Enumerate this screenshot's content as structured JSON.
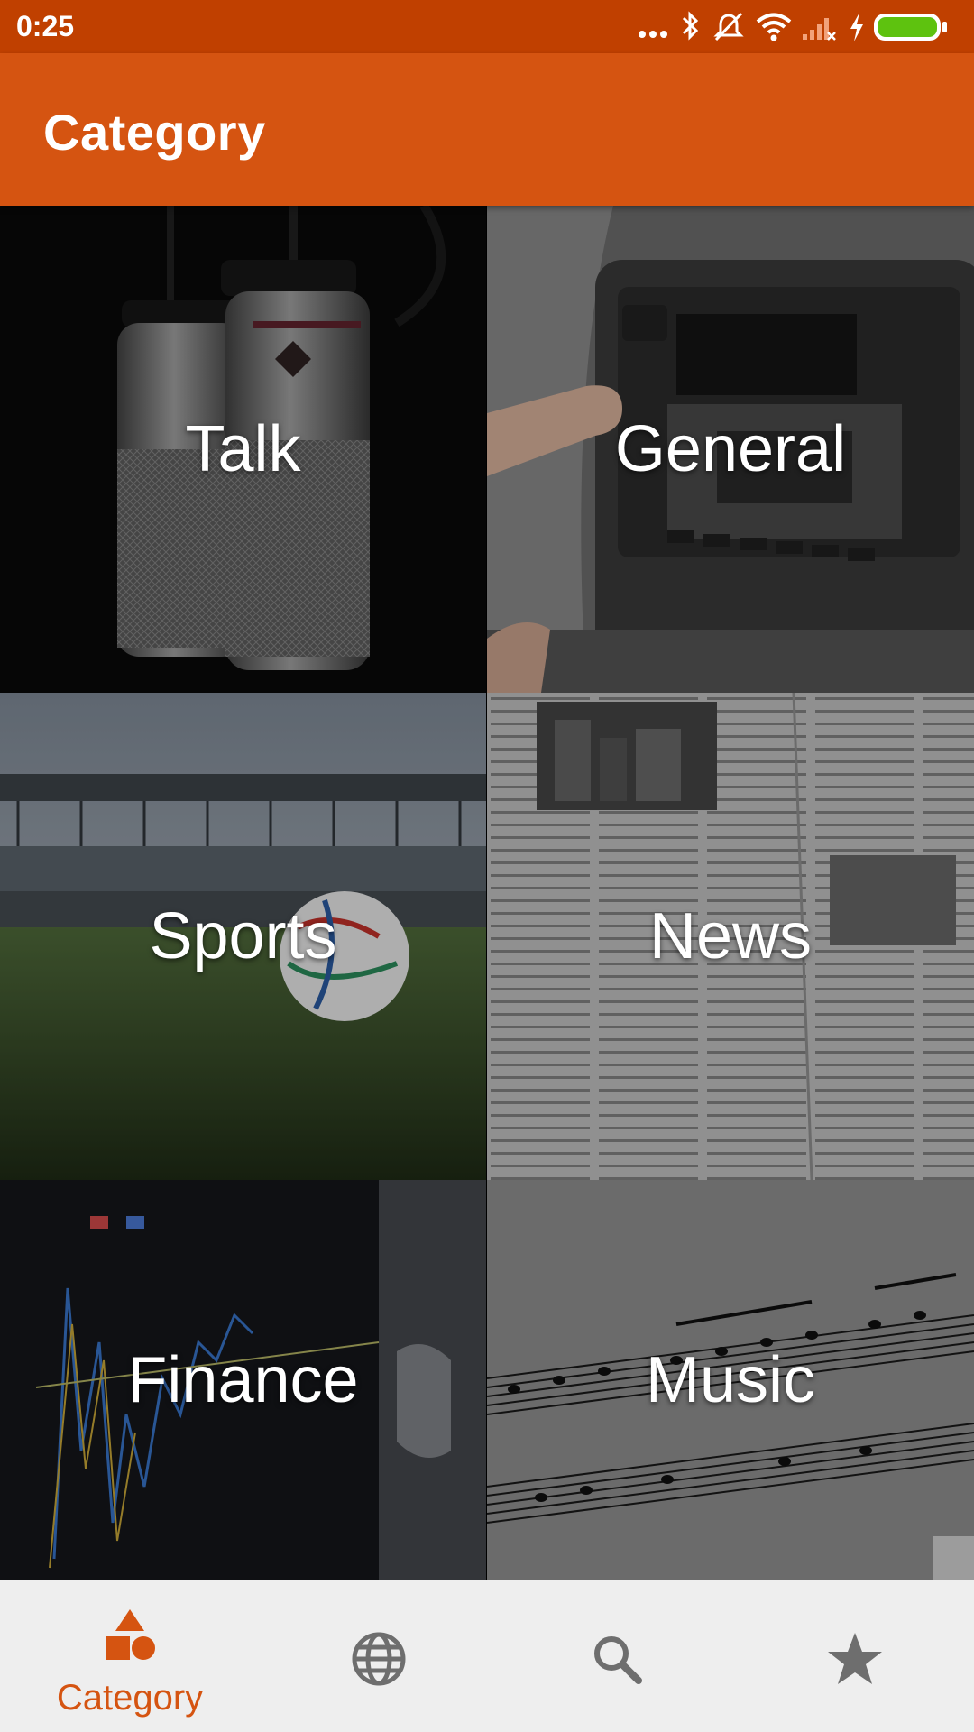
{
  "status_bar": {
    "time": "0:25",
    "icons": [
      "more-dots-icon",
      "bluetooth-icon",
      "vibrate-off-icon",
      "wifi-icon",
      "no-signal-icon",
      "charging-bolt-icon",
      "battery-icon"
    ]
  },
  "app_bar": {
    "title": "Category"
  },
  "categories": [
    {
      "label": "Talk",
      "image": "studio-microphones"
    },
    {
      "label": "General",
      "image": "car-radio"
    },
    {
      "label": "Sports",
      "image": "stadium-soccer-ball"
    },
    {
      "label": "News",
      "image": "newspaper"
    },
    {
      "label": "Finance",
      "image": "stock-chart"
    },
    {
      "label": "Music",
      "image": "sheet-music"
    }
  ],
  "bottom_nav": {
    "active_index": 0,
    "items": [
      {
        "icon": "category-shapes-icon",
        "label": "Category"
      },
      {
        "icon": "globe-icon"
      },
      {
        "icon": "search-icon"
      },
      {
        "icon": "star-icon"
      }
    ]
  },
  "colors": {
    "status_bar": "#c04000",
    "app_bar": "#d55411",
    "accent": "#d55411",
    "nav_inactive": "#6e6e6e",
    "nav_background": "#eeeeee"
  }
}
